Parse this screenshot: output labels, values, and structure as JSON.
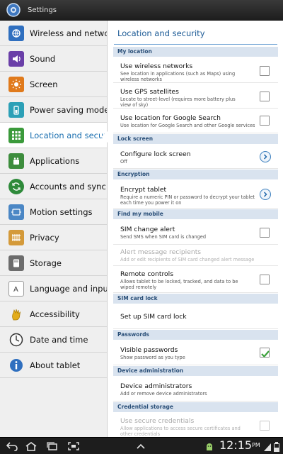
{
  "titlebar": {
    "title": "Settings"
  },
  "sidebar": {
    "items": [
      {
        "label": "Wireless and networks",
        "icon": "wireless-icon",
        "color": "#2f6fbf"
      },
      {
        "label": "Sound",
        "icon": "sound-icon",
        "color": "#6a3fa8"
      },
      {
        "label": "Screen",
        "icon": "screen-icon",
        "color": "#e07a1c"
      },
      {
        "label": "Power saving mode",
        "icon": "power-saving-icon",
        "color": "#2ca0b7"
      },
      {
        "label": "Location and security",
        "icon": "location-icon",
        "color": "#3b9a3b"
      },
      {
        "label": "Applications",
        "icon": "applications-icon",
        "color": "#3d8d3d"
      },
      {
        "label": "Accounts and sync",
        "icon": "sync-icon",
        "color": "#2e8a3a"
      },
      {
        "label": "Motion settings",
        "icon": "motion-icon",
        "color": "#4b87c5"
      },
      {
        "label": "Privacy",
        "icon": "privacy-icon",
        "color": "#d49a3a"
      },
      {
        "label": "Storage",
        "icon": "storage-icon",
        "color": "#6c6c6c"
      },
      {
        "label": "Language and input",
        "icon": "language-icon",
        "color": "#5a5a5a"
      },
      {
        "label": "Accessibility",
        "icon": "accessibility-icon",
        "color": "#d8a000"
      },
      {
        "label": "Date and time",
        "icon": "clock-icon",
        "color": "#444444"
      },
      {
        "label": "About tablet",
        "icon": "info-icon",
        "color": "#2f6fbf"
      }
    ],
    "selected_index": 4
  },
  "content": {
    "title": "Location and security",
    "sections": {
      "my_location": "My location",
      "lock_screen": "Lock screen",
      "encryption": "Encryption",
      "find_my_mobile": "Find my mobile",
      "sim_card_lock": "SIM card lock",
      "passwords": "Passwords",
      "device_admin": "Device administration",
      "credential_storage": "Credential storage"
    },
    "rows": {
      "wireless_networks": {
        "title": "Use wireless networks",
        "subtitle": "See location in applications (such as Maps) using wireless networks",
        "checked": false
      },
      "gps": {
        "title": "Use GPS satellites",
        "subtitle": "Locate to street-level (requires more battery plus view of sky)",
        "checked": false
      },
      "google_search": {
        "title": "Use location for Google Search",
        "subtitle": "Use location for Google Search and other Google services",
        "checked": false
      },
      "configure_lock": {
        "title": "Configure lock screen",
        "subtitle": "Off"
      },
      "encrypt": {
        "title": "Encrypt tablet",
        "subtitle": "Require a numeric PIN or password to decrypt your tablet each time you power it on"
      },
      "sim_change": {
        "title": "SIM change alert",
        "subtitle": "Send SMS when SIM card is changed",
        "checked": false
      },
      "alert_recipients": {
        "title": "Alert message recipients",
        "subtitle": "Add or edit recipients of SIM card changed alert message",
        "disabled": true
      },
      "remote_controls": {
        "title": "Remote controls",
        "subtitle": "Allows tablet to be locked, tracked, and data to be wiped remotely",
        "checked": false
      },
      "sim_lock": {
        "title": "Set up SIM card lock"
      },
      "visible_passwords": {
        "title": "Visible passwords",
        "subtitle": "Show password as you type",
        "checked": true
      },
      "device_admins": {
        "title": "Device administrators",
        "subtitle": "Add or remove device administrators"
      },
      "secure_credentials": {
        "title": "Use secure credentials",
        "subtitle": "Allow applications to access secure certificates and other credentials",
        "checked": false,
        "disabled": true
      }
    }
  },
  "statusbar": {
    "time": "12:15",
    "ampm": "PM"
  },
  "colors": {
    "accent": "#1b5a95",
    "check": "#3aa03a"
  }
}
